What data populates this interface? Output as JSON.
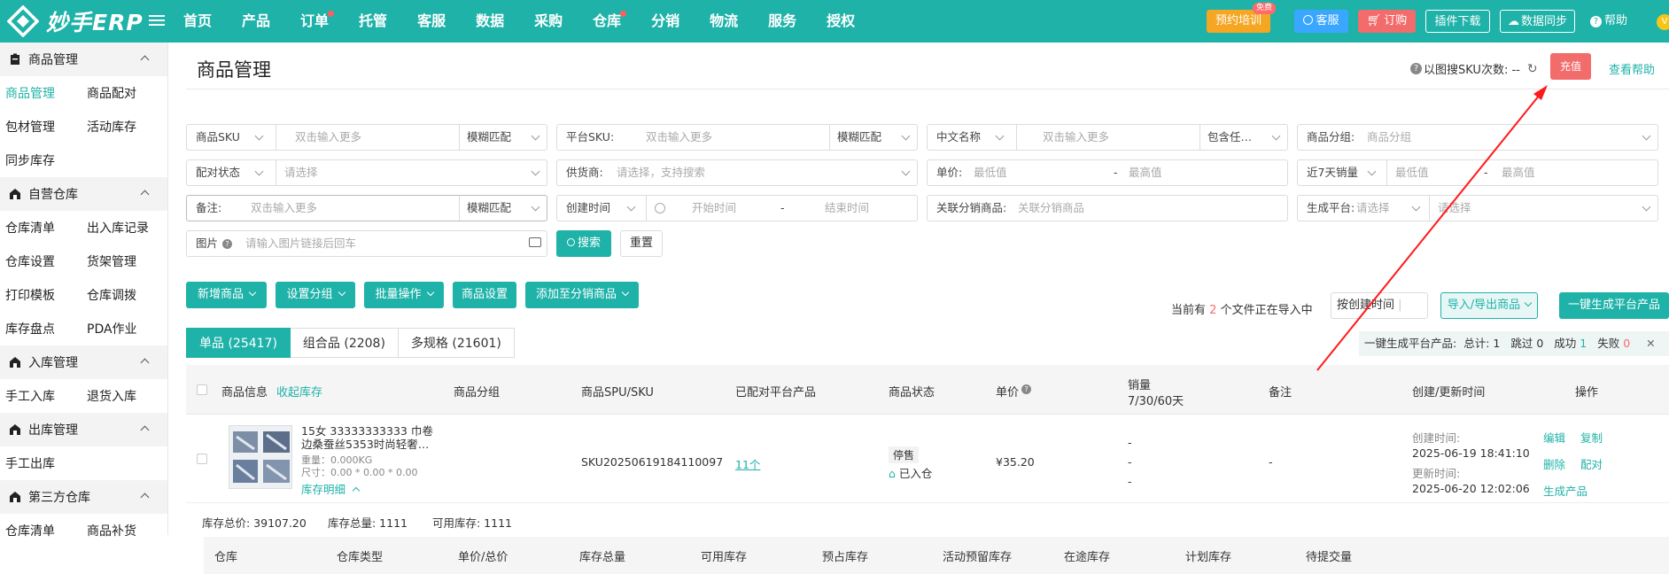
{
  "app": {
    "logo_text": "妙手ERP"
  },
  "nav": [
    "首页",
    "产品",
    "订单",
    "托管",
    "客服",
    "数据",
    "采购",
    "仓库",
    "分销",
    "物流",
    "服务",
    "授权"
  ],
  "nav_dots": [
    2,
    7
  ],
  "topbar": {
    "training": "预约培训",
    "training_badge": "免费",
    "service": "客服",
    "order": "订购",
    "plugin": "插件下载",
    "sync": "数据同步",
    "help": "帮助",
    "avatar": "V"
  },
  "sidebar": {
    "groups": [
      {
        "title": "商品管理",
        "icon": "clipboard-icon",
        "items": [
          "商品管理",
          "商品配对",
          "包材管理",
          "活动库存",
          "同步库存"
        ]
      },
      {
        "title": "自营仓库",
        "icon": "warehouse-icon",
        "items": [
          "仓库清单",
          "出入库记录",
          "仓库设置",
          "货架管理",
          "打印模板",
          "仓库调拨",
          "库存盘点",
          "PDA作业"
        ]
      },
      {
        "title": "入库管理",
        "icon": "warehouse-icon",
        "items": [
          "手工入库",
          "退货入库"
        ]
      },
      {
        "title": "出库管理",
        "icon": "warehouse-icon",
        "items": [
          "手工出库"
        ]
      },
      {
        "title": "第三方仓库",
        "icon": "warehouse-icon",
        "items": [
          "仓库清单",
          "商品补货"
        ]
      }
    ],
    "active": "商品管理"
  },
  "page": {
    "title": "商品管理",
    "sku_search_text": "以图搜SKU次数: --",
    "recharge": "充值",
    "view_help": "查看帮助"
  },
  "filters": {
    "sku_select": "商品SKU",
    "sku_ph": "双击输入更多",
    "sku_match": "模糊匹配",
    "platform_sku_label": "平台SKU:",
    "platform_sku_ph": "双击输入更多",
    "platform_sku_match": "模糊匹配",
    "cn_name_select": "中文名称",
    "cn_name_ph": "双击输入更多",
    "cn_name_match": "包含任…",
    "group_label": "商品分组:",
    "group_ph": "商品分组",
    "pair_select": "配对状态",
    "pair_ph": "请选择",
    "supplier_label": "供货商:",
    "supplier_ph": "请选择，支持搜索",
    "price_label": "单价:",
    "price_min": "最低值",
    "dash": "-",
    "price_max": "最高值",
    "sales_select": "近7天销量",
    "sales_min": "最低值",
    "sales_max": "最高值",
    "remark_label": "备注:",
    "remark_ph": "双击输入更多",
    "remark_match": "模糊匹配",
    "time_select": "创建时间",
    "start_ph": "开始时间",
    "end_ph": "结束时间",
    "dist_label": "关联分销商品:",
    "dist_ph": "关联分销商品",
    "platform_label": "生成平台:",
    "platform_ph": "请选择",
    "platform_ph2": "请选择",
    "image_label": "图片",
    "image_ph": "请输入图片链接后回车",
    "search_btn": "搜索",
    "reset_btn": "重置"
  },
  "toolbar": {
    "add": "新增商品",
    "group": "设置分组",
    "batch": "批量操作",
    "settings": "商品设置",
    "add_dist": "添加至分销商品",
    "import_prefix": "当前有",
    "import_count": "2",
    "import_suffix": "个文件正在导入中",
    "sort": "按创建时间",
    "import_export": "导入/导出商品",
    "gen_platform": "一键生成平台产品"
  },
  "tabs": [
    "单品 (25417)",
    "组合品 (2208)",
    "多规格 (21601)"
  ],
  "gen_status": {
    "label": "一键生成平台产品:",
    "total_label": "总计:",
    "total": "1",
    "skip_label": "跳过",
    "skip": "0",
    "ok_label": "成功",
    "ok": "1",
    "fail_label": "失败",
    "fail": "0"
  },
  "table": {
    "headers": {
      "info": "商品信息",
      "collapse": "收起库存",
      "group": "商品分组",
      "spu": "商品SPU/SKU",
      "paired": "已配对平台产品",
      "status": "商品状态",
      "price": "单价",
      "sales": "销量",
      "sales_sub": "7/30/60天",
      "remark": "备注",
      "time": "创建/更新时间",
      "ops": "操作"
    },
    "row": {
      "title": "15女 33333333333 巾卷边桑蚕丝5353时尚轻奢…",
      "weight": "重量：0.000KG",
      "size": "尺寸：0.00 * 0.00 * 0.00",
      "stock_detail": "库存明细",
      "sku": "SKU20250619184110097",
      "paired": "11个",
      "status_badge": "停售",
      "status_stock": "已入仓",
      "price": "¥35.20",
      "sales": [
        "-",
        "-",
        "-"
      ],
      "remark": "-",
      "created_label": "创建时间:",
      "created": "2025-06-19 18:41:10",
      "updated_label": "更新时间:",
      "updated": "2025-06-20 12:02:06",
      "ops": [
        "编辑",
        "复制",
        "删除",
        "配对",
        "生成产品"
      ]
    },
    "inventory_summary": [
      "库存总价:  39107.20",
      "库存总量:  1111",
      "可用库存:  1111"
    ],
    "inventory_headers": [
      "仓库",
      "仓库类型",
      "单价/总价",
      "库存总量",
      "可用库存",
      "预占库存",
      "活动预留库存",
      "在途库存",
      "计划库存",
      "待提交量"
    ]
  }
}
